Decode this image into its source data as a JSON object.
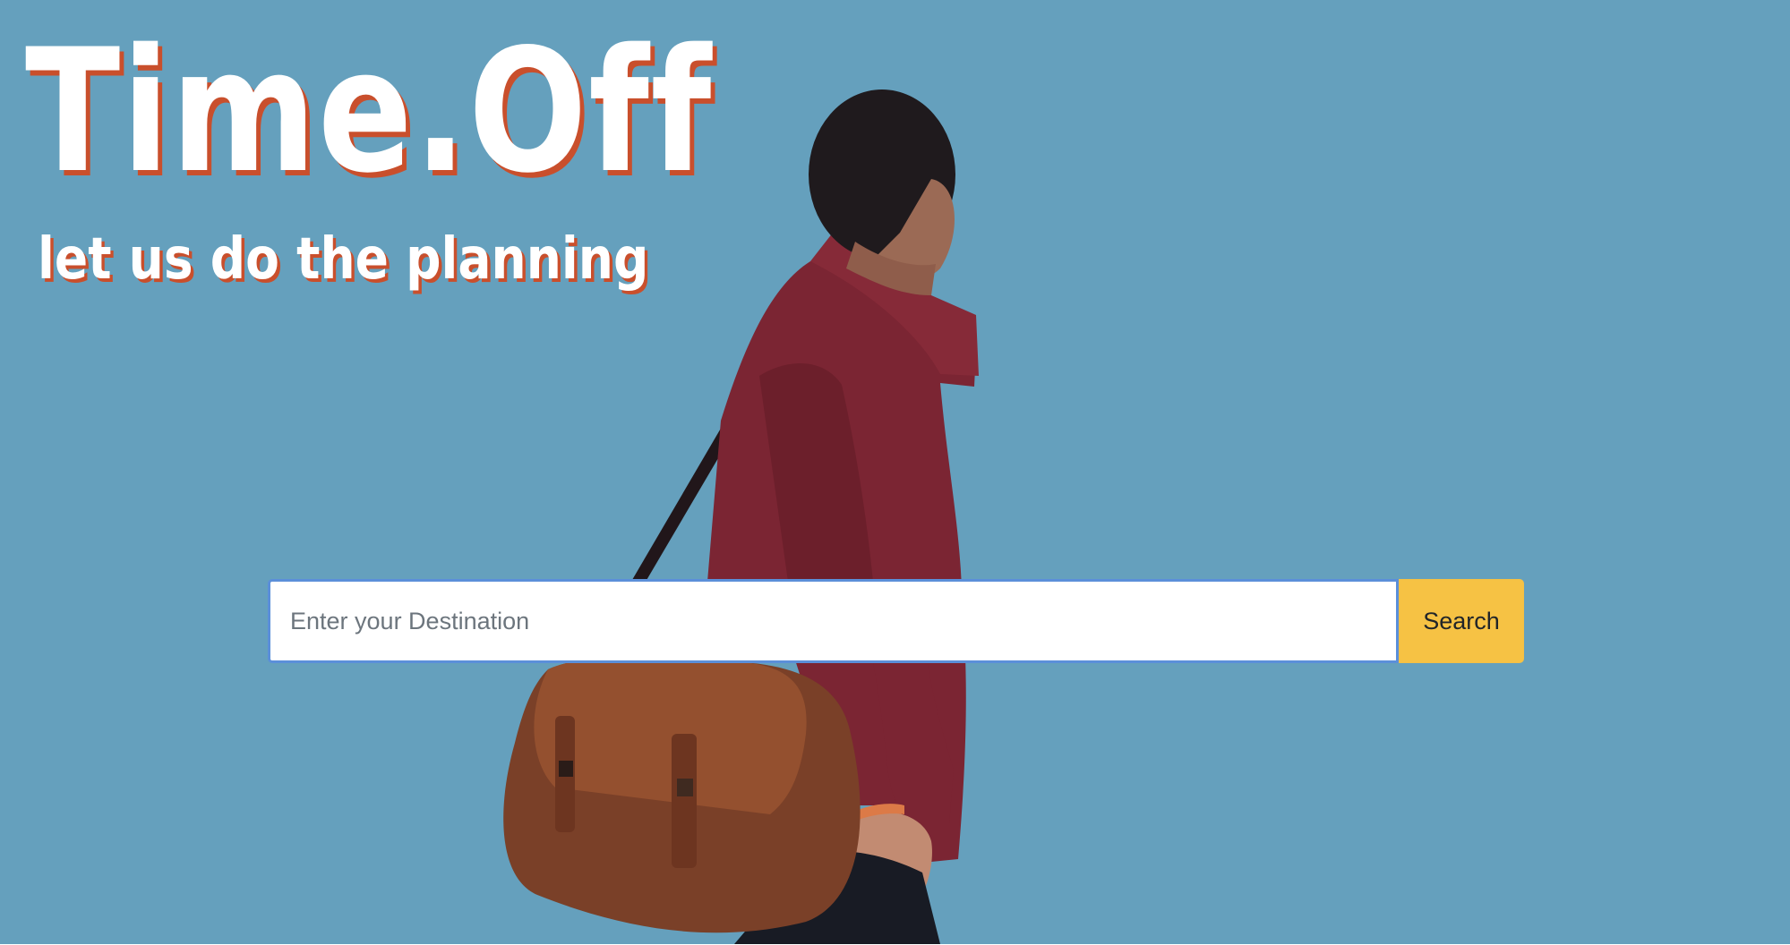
{
  "colors": {
    "background": "#65a0bd",
    "title_shadow": "#c94f2c",
    "button": "#f6c244",
    "input_border": "#5b8fd9"
  },
  "hero": {
    "title": "Time.Off",
    "tagline": "let us do the planning",
    "image": "traveler-with-messenger-bag"
  },
  "search": {
    "placeholder": "Enter your Destination",
    "value": "",
    "button_label": "Search"
  }
}
